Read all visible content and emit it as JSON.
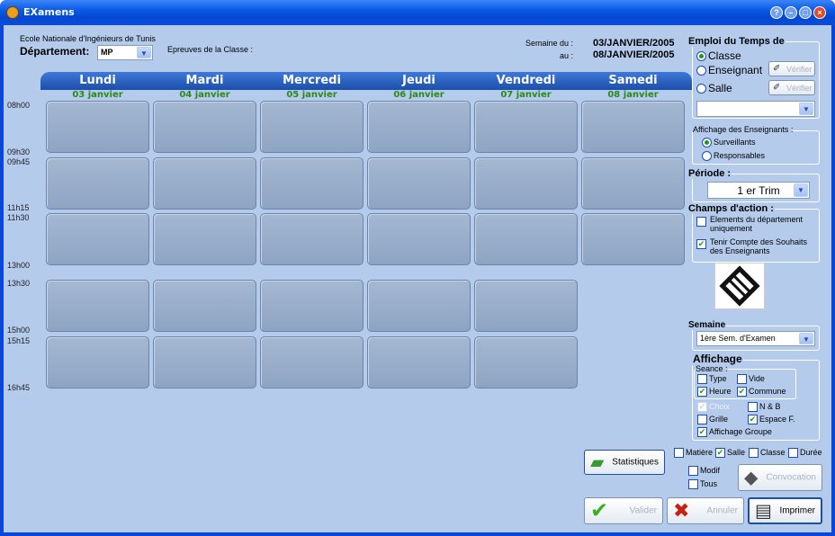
{
  "window": {
    "title": "EXamens",
    "controls": [
      "minimize",
      "restore",
      "maximize",
      "close"
    ]
  },
  "header": {
    "school": "Ecole Nationale d'Ingénieurs de Tunis",
    "departement_label": "Département:",
    "departement_value": "MP",
    "epreuves_label": "Epreuves de la Classe :",
    "semaine_du_label": "Semaine du :",
    "au_label": "au :",
    "semaine_du_value": "03/JANVIER/2005",
    "au_value": "08/JANVIER/2005"
  },
  "days": [
    {
      "name": "Lundi",
      "date": "03 janvier"
    },
    {
      "name": "Mardi",
      "date": "04 janvier"
    },
    {
      "name": "Mercredi",
      "date": "05 janvier"
    },
    {
      "name": "Jeudi",
      "date": "06 janvier"
    },
    {
      "name": "Vendredi",
      "date": "07 janvier"
    },
    {
      "name": "Samedi",
      "date": "08 janvier"
    }
  ],
  "times": [
    "08h00",
    "09h30",
    "09h45",
    "11h15",
    "11h30",
    "13h00",
    "13h30",
    "15h00",
    "15h15",
    "16h45"
  ],
  "emploi": {
    "title": "Emploi du Temps de",
    "classe": "Classe",
    "enseignant": "Enseignant",
    "salle": "Salle",
    "verifier": "Vérifier",
    "selected": "Classe",
    "dropdown_value": ""
  },
  "affichage_enseignants": {
    "title": "Affichage des Enseignants :",
    "surveillants": "Surveillants",
    "responsables": "Responsables",
    "selected": "Surveillants"
  },
  "periode": {
    "title": "Période :",
    "value": "1 er Trim"
  },
  "champs": {
    "title": "Champs d'action :",
    "elements": "Elements du département uniquement",
    "elements_checked": false,
    "tenir": "Tenir Compte des Souhaits des Enseignants",
    "tenir_checked": true
  },
  "semaine": {
    "title": "Semaine",
    "value": "1ère Sem. d'Examen"
  },
  "affichage": {
    "title": "Affichage",
    "seance_label": "Seance :",
    "type": "Type",
    "vide": "Vide",
    "heure": "Heure",
    "commune": "Commune",
    "choix": "Choix",
    "nb": "N & B",
    "grille": "Grille",
    "espace": "Espace F.",
    "groupe": "Affichage Groupe"
  },
  "footer": {
    "statistiques": "Statistiques",
    "matiere": "Matière",
    "salle": "Salle",
    "classe": "Classe",
    "duree": "Durée",
    "modif": "Modif",
    "tous": "Tous",
    "convocation": "Convocation",
    "valider": "Valider",
    "annuler": "Annuler",
    "imprimer": "Imprimer"
  },
  "colors": {
    "accent": "#1c4faa",
    "date_green": "#2a8a18",
    "panel": "#b4cbec",
    "cell": "#97abc8"
  }
}
